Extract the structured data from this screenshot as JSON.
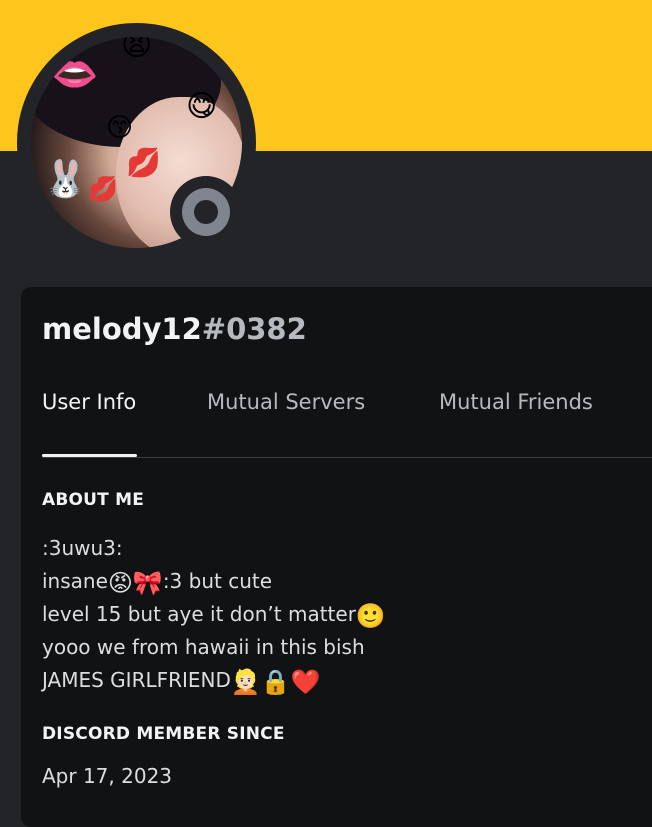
{
  "colors": {
    "banner": "#fec51c",
    "background": "#232428",
    "card": "#111214",
    "status_offline": "#80848e",
    "text_primary": "#f2f3f5",
    "text_muted": "#b5bac1"
  },
  "profile": {
    "username": "melody12",
    "discriminator": "#0382",
    "avatar_icon": "avatar-image",
    "status_icon": "offline-status-icon"
  },
  "tabs": [
    {
      "label": "User Info",
      "active": true
    },
    {
      "label": "Mutual Servers",
      "active": false
    },
    {
      "label": "Mutual Friends",
      "active": false
    }
  ],
  "about_me": {
    "title": "ABOUT ME",
    "lines": [
      {
        "text": ":3uwu3:"
      },
      {
        "text_before": "insane",
        "emojis": [
          "😡",
          "🎀"
        ],
        "text_after": ":3 but cute"
      },
      {
        "text": "level 15 but aye it don’t matter",
        "emojis": [
          "🙂"
        ]
      },
      {
        "text": "yooo we from hawaii in this bish"
      },
      {
        "text": "JAMES GIRLFRIEND",
        "emojis": [
          "👱🏻",
          "🔒",
          "❤️"
        ]
      }
    ]
  },
  "member_since": {
    "title": "DISCORD MEMBER SINCE",
    "date": "Apr 17, 2023"
  }
}
